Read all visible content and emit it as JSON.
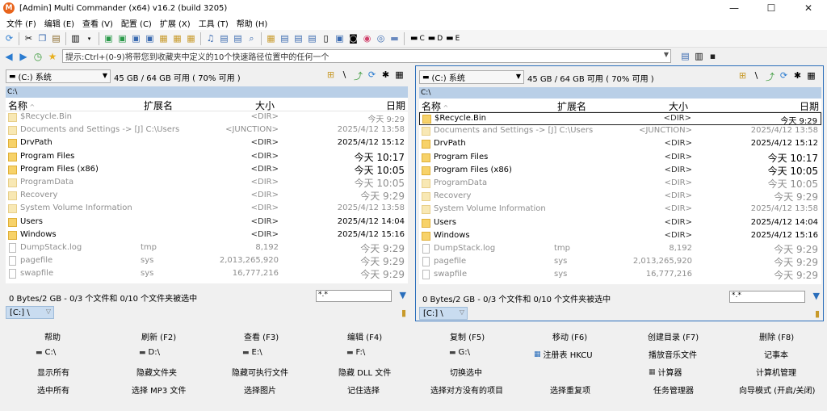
{
  "window": {
    "title": "[Admin] Multi Commander (x64)  v16.2 (build 3205)",
    "app_icon": "M"
  },
  "menu": [
    "文件 (F)",
    "编辑 (E)",
    "查看 (V)",
    "配置 (C)",
    "扩展 (X)",
    "工具 (T)",
    "帮助 (H)"
  ],
  "toolbar": {
    "drives": [
      "C",
      "D",
      "E"
    ]
  },
  "address": {
    "placeholder": "提示:Ctrl+(0-9)将带您到收藏夹中定义的10个快速路径位置中的任何一个"
  },
  "panels": [
    {
      "drive": "(C:) 系统",
      "free": "45 GB / 64 GB 可用 ( 70% 可用 )",
      "path": "C:\\",
      "columns": {
        "name": "名称",
        "ext": "扩展名",
        "size": "大小",
        "date": "日期"
      },
      "files": [
        {
          "name": "$Recycle.Bin",
          "ext": "",
          "size": "<DIR>",
          "date": "今天 9:29",
          "type": "folder",
          "hidden": true,
          "today": false
        },
        {
          "name": "Documents and Settings ->  [J] C:\\Users",
          "ext": "",
          "size": "<JUNCTION>",
          "date": "2025/4/12 13:58",
          "type": "folder",
          "hidden": true,
          "today": false
        },
        {
          "name": "DrvPath",
          "ext": "",
          "size": "<DIR>",
          "date": "2025/4/12 15:12",
          "type": "folder",
          "hidden": false,
          "today": false
        },
        {
          "name": "Program Files",
          "ext": "",
          "size": "<DIR>",
          "date": "今天 10:17",
          "type": "folder",
          "hidden": false,
          "today": true
        },
        {
          "name": "Program Files (x86)",
          "ext": "",
          "size": "<DIR>",
          "date": "今天 10:05",
          "type": "folder",
          "hidden": false,
          "today": true
        },
        {
          "name": "ProgramData",
          "ext": "",
          "size": "<DIR>",
          "date": "今天 10:05",
          "type": "folder",
          "hidden": true,
          "today": true
        },
        {
          "name": "Recovery",
          "ext": "",
          "size": "<DIR>",
          "date": "今天 9:29",
          "type": "folder",
          "hidden": true,
          "today": true
        },
        {
          "name": "System Volume Information",
          "ext": "",
          "size": "<DIR>",
          "date": "2025/4/12 13:58",
          "type": "folder",
          "hidden": true,
          "today": false
        },
        {
          "name": "Users",
          "ext": "",
          "size": "<DIR>",
          "date": "2025/4/12 14:04",
          "type": "folder",
          "hidden": false,
          "today": false
        },
        {
          "name": "Windows",
          "ext": "",
          "size": "<DIR>",
          "date": "2025/4/12 15:16",
          "type": "folder",
          "hidden": false,
          "today": false
        },
        {
          "name": "DumpStack.log",
          "ext": "tmp",
          "size": "8,192",
          "date": "今天 9:29",
          "type": "file",
          "hidden": true,
          "today": true
        },
        {
          "name": "pagefile",
          "ext": "sys",
          "size": "2,013,265,920",
          "date": "今天 9:29",
          "type": "file",
          "hidden": true,
          "today": true
        },
        {
          "name": "swapfile",
          "ext": "sys",
          "size": "16,777,216",
          "date": "今天 9:29",
          "type": "file",
          "hidden": true,
          "today": true
        }
      ],
      "status": "0 Bytes/2 GB - 0/3 个文件和 0/10 个文件夹被选中",
      "filter": "*.*",
      "tab": "[C:] \\"
    },
    {
      "drive": "(C:) 系统",
      "free": "45 GB / 64 GB 可用 ( 70% 可用 )",
      "path": "C:\\",
      "columns": {
        "name": "名称",
        "ext": "扩展名",
        "size": "大小",
        "date": "日期"
      },
      "files": [
        {
          "name": "$Recycle.Bin",
          "ext": "",
          "size": "<DIR>",
          "date": "今天 9:29",
          "type": "folder",
          "hidden": false,
          "today": false
        },
        {
          "name": "Documents and Settings ->  [J] C:\\Users",
          "ext": "",
          "size": "<JUNCTION>",
          "date": "2025/4/12 13:58",
          "type": "folder",
          "hidden": true,
          "today": false
        },
        {
          "name": "DrvPath",
          "ext": "",
          "size": "<DIR>",
          "date": "2025/4/12 15:12",
          "type": "folder",
          "hidden": false,
          "today": false
        },
        {
          "name": "Program Files",
          "ext": "",
          "size": "<DIR>",
          "date": "今天 10:17",
          "type": "folder",
          "hidden": false,
          "today": true
        },
        {
          "name": "Program Files (x86)",
          "ext": "",
          "size": "<DIR>",
          "date": "今天 10:05",
          "type": "folder",
          "hidden": false,
          "today": true
        },
        {
          "name": "ProgramData",
          "ext": "",
          "size": "<DIR>",
          "date": "今天 10:05",
          "type": "folder",
          "hidden": true,
          "today": true
        },
        {
          "name": "Recovery",
          "ext": "",
          "size": "<DIR>",
          "date": "今天 9:29",
          "type": "folder",
          "hidden": true,
          "today": true
        },
        {
          "name": "System Volume Information",
          "ext": "",
          "size": "<DIR>",
          "date": "2025/4/12 13:58",
          "type": "folder",
          "hidden": true,
          "today": false
        },
        {
          "name": "Users",
          "ext": "",
          "size": "<DIR>",
          "date": "2025/4/12 14:04",
          "type": "folder",
          "hidden": false,
          "today": false
        },
        {
          "name": "Windows",
          "ext": "",
          "size": "<DIR>",
          "date": "2025/4/12 15:16",
          "type": "folder",
          "hidden": false,
          "today": false
        },
        {
          "name": "DumpStack.log",
          "ext": "tmp",
          "size": "8,192",
          "date": "今天 9:29",
          "type": "file",
          "hidden": true,
          "today": true
        },
        {
          "name": "pagefile",
          "ext": "sys",
          "size": "2,013,265,920",
          "date": "今天 9:29",
          "type": "file",
          "hidden": true,
          "today": true
        },
        {
          "name": "swapfile",
          "ext": "sys",
          "size": "16,777,216",
          "date": "今天 9:29",
          "type": "file",
          "hidden": true,
          "today": true
        }
      ],
      "status": "0 Bytes/2 GB - 0/3 个文件和 0/10 个文件夹被选中",
      "filter": "*.*",
      "tab": "[C:] \\"
    }
  ],
  "fkeys": [
    [
      "帮助",
      "刷新 (F2)",
      "查看 (F3)",
      "编辑 (F4)",
      "复制 (F5)",
      "移动 (F6)",
      "创建目录 (F7)",
      "删除 (F8)"
    ],
    [
      "C:\\",
      "D:\\",
      "E:\\",
      "F:\\",
      "G:\\",
      "注册表 HKCU",
      "播放音乐文件",
      "记事本"
    ],
    [
      "显示所有",
      "隐藏文件夹",
      "隐藏可执行文件",
      "隐藏 DLL 文件",
      "切换选中",
      "",
      "计算器",
      "计算机管理"
    ],
    [
      "选中所有",
      "选择 MP3 文件",
      "选择图片",
      "记住选择",
      "选择对方没有的项目",
      "选择重复项",
      "任务管理器",
      "向导模式 (开启/关闭)"
    ]
  ]
}
